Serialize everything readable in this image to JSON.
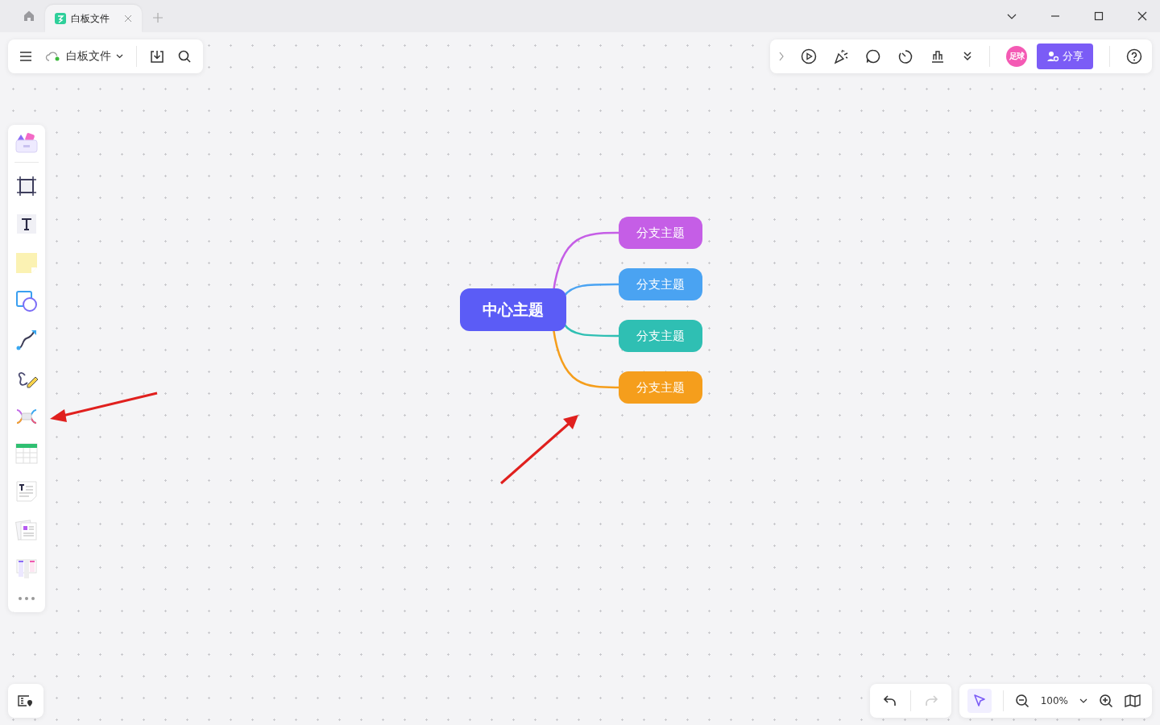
{
  "tabs": [
    {
      "label": "白板文件",
      "selected": true
    }
  ],
  "file_menu": {
    "title": "白板文件",
    "synced": true
  },
  "top_toolbar": {
    "avatar": "足球",
    "share_button": "分享"
  },
  "mind_map": {
    "center": {
      "label": "中心主题",
      "color": "#5b5cf6"
    },
    "branches": [
      {
        "label": "分支主题",
        "color": "#c55ee6"
      },
      {
        "label": "分支主题",
        "color": "#4aa3f2"
      },
      {
        "label": "分支主题",
        "color": "#2fbfb3"
      },
      {
        "label": "分支主题",
        "color": "#f59e1c"
      }
    ]
  },
  "history": {
    "undo_disabled": false,
    "redo_disabled": true
  },
  "zoom_bar": {
    "select_selected": true,
    "zoom": "100%"
  }
}
